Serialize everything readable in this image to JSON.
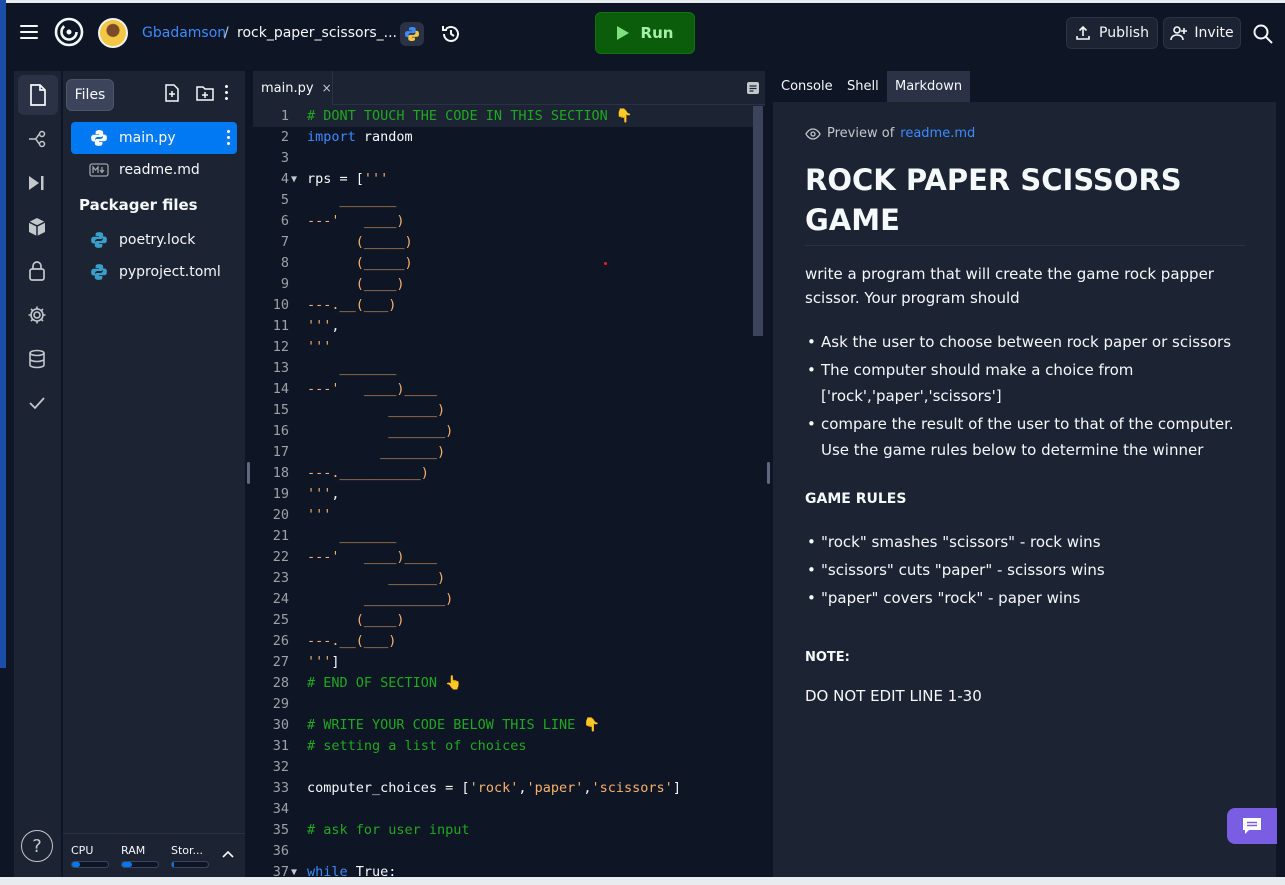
{
  "header": {
    "owner": "Gbadamson",
    "separator": "/",
    "repl_name": "rock_paper_scissors_...",
    "run_label": "Run",
    "publish_label": "Publish",
    "invite_label": "Invite"
  },
  "files_panel": {
    "tab_label": "Files",
    "files": [
      {
        "name": "main.py",
        "icon": "python-icon"
      },
      {
        "name": "readme.md",
        "icon": "markdown-icon"
      }
    ],
    "packager_title": "Packager files",
    "packager_files": [
      {
        "name": "poetry.lock",
        "icon": "python-icon"
      },
      {
        "name": "pyproject.toml",
        "icon": "python-icon"
      }
    ],
    "resources": [
      {
        "label": "CPU",
        "fill": 0.22
      },
      {
        "label": "RAM",
        "fill": 0.28
      },
      {
        "label": "Stor...",
        "fill": 0.05
      }
    ]
  },
  "editor": {
    "tab_label": "main.py",
    "tab_close": "×",
    "lines": [
      {
        "n": "1",
        "fold": "",
        "parts": [
          {
            "c": "c-cmt",
            "t": "# DONT TOUCH THE CODE IN THIS SECTION 👇"
          }
        ]
      },
      {
        "n": "2",
        "fold": "",
        "parts": [
          {
            "c": "c-kw",
            "t": "import"
          },
          {
            "c": "c-ident",
            "t": " random"
          }
        ]
      },
      {
        "n": "3",
        "fold": "",
        "parts": []
      },
      {
        "n": "4",
        "fold": "▼",
        "parts": [
          {
            "c": "c-ident",
            "t": "rps = ["
          },
          {
            "c": "c-str",
            "t": "'''"
          }
        ]
      },
      {
        "n": "5",
        "fold": "",
        "parts": [
          {
            "c": "c-str",
            "t": "    _______"
          }
        ]
      },
      {
        "n": "6",
        "fold": "",
        "parts": [
          {
            "c": "c-str",
            "t": "---'   ____)"
          }
        ]
      },
      {
        "n": "7",
        "fold": "",
        "parts": [
          {
            "c": "c-str",
            "t": "      (_____)"
          }
        ]
      },
      {
        "n": "8",
        "fold": "",
        "parts": [
          {
            "c": "c-str",
            "t": "      (_____)"
          }
        ]
      },
      {
        "n": "9",
        "fold": "",
        "parts": [
          {
            "c": "c-str",
            "t": "      (____)"
          }
        ]
      },
      {
        "n": "10",
        "fold": "",
        "parts": [
          {
            "c": "c-str",
            "t": "---.__(___)"
          }
        ]
      },
      {
        "n": "11",
        "fold": "",
        "parts": [
          {
            "c": "c-str",
            "t": "'''"
          },
          {
            "c": "c-ident",
            "t": ","
          }
        ]
      },
      {
        "n": "12",
        "fold": "",
        "parts": [
          {
            "c": "c-str",
            "t": "'''"
          }
        ]
      },
      {
        "n": "13",
        "fold": "",
        "parts": [
          {
            "c": "c-str",
            "t": "    _______"
          }
        ]
      },
      {
        "n": "14",
        "fold": "",
        "parts": [
          {
            "c": "c-str",
            "t": "---'   ____)____"
          }
        ]
      },
      {
        "n": "15",
        "fold": "",
        "parts": [
          {
            "c": "c-str",
            "t": "          ______)"
          }
        ]
      },
      {
        "n": "16",
        "fold": "",
        "parts": [
          {
            "c": "c-str",
            "t": "          _______)"
          }
        ]
      },
      {
        "n": "17",
        "fold": "",
        "parts": [
          {
            "c": "c-str",
            "t": "         _______)"
          }
        ]
      },
      {
        "n": "18",
        "fold": "",
        "parts": [
          {
            "c": "c-str",
            "t": "---.__________)"
          }
        ]
      },
      {
        "n": "19",
        "fold": "",
        "parts": [
          {
            "c": "c-str",
            "t": "'''"
          },
          {
            "c": "c-ident",
            "t": ","
          }
        ]
      },
      {
        "n": "20",
        "fold": "",
        "parts": [
          {
            "c": "c-str",
            "t": "'''"
          }
        ]
      },
      {
        "n": "21",
        "fold": "",
        "parts": [
          {
            "c": "c-str",
            "t": "    _______"
          }
        ]
      },
      {
        "n": "22",
        "fold": "",
        "parts": [
          {
            "c": "c-str",
            "t": "---'   ____)____"
          }
        ]
      },
      {
        "n": "23",
        "fold": "",
        "parts": [
          {
            "c": "c-str",
            "t": "          ______)"
          }
        ]
      },
      {
        "n": "24",
        "fold": "",
        "parts": [
          {
            "c": "c-str",
            "t": "       __________)"
          }
        ]
      },
      {
        "n": "25",
        "fold": "",
        "parts": [
          {
            "c": "c-str",
            "t": "      (____)"
          }
        ]
      },
      {
        "n": "26",
        "fold": "",
        "parts": [
          {
            "c": "c-str",
            "t": "---.__(___)"
          }
        ]
      },
      {
        "n": "27",
        "fold": "",
        "parts": [
          {
            "c": "c-str",
            "t": "'''"
          },
          {
            "c": "c-ident",
            "t": "]"
          }
        ]
      },
      {
        "n": "28",
        "fold": "",
        "parts": [
          {
            "c": "c-cmt",
            "t": "# END OF SECTION 👆"
          }
        ]
      },
      {
        "n": "29",
        "fold": "",
        "parts": []
      },
      {
        "n": "30",
        "fold": "",
        "parts": [
          {
            "c": "c-cmt",
            "t": "# WRITE YOUR CODE BELOW THIS LINE 👇"
          }
        ]
      },
      {
        "n": "31",
        "fold": "",
        "parts": [
          {
            "c": "c-cmt",
            "t": "# setting a list of choices"
          }
        ]
      },
      {
        "n": "32",
        "fold": "",
        "parts": []
      },
      {
        "n": "33",
        "fold": "",
        "parts": [
          {
            "c": "c-ident",
            "t": "computer_choices = ["
          },
          {
            "c": "c-str",
            "t": "'rock'"
          },
          {
            "c": "c-ident",
            "t": ","
          },
          {
            "c": "c-str",
            "t": "'paper'"
          },
          {
            "c": "c-ident",
            "t": ","
          },
          {
            "c": "c-str",
            "t": "'scissors'"
          },
          {
            "c": "c-ident",
            "t": "]"
          }
        ]
      },
      {
        "n": "34",
        "fold": "",
        "parts": []
      },
      {
        "n": "35",
        "fold": "",
        "parts": [
          {
            "c": "c-cmt",
            "t": "# ask for user input"
          }
        ]
      },
      {
        "n": "36",
        "fold": "",
        "parts": []
      },
      {
        "n": "37",
        "fold": "▼",
        "parts": [
          {
            "c": "c-kw",
            "t": "while"
          },
          {
            "c": "c-ident",
            "t": " True:"
          }
        ]
      }
    ]
  },
  "right_pane": {
    "tabs": [
      "Console",
      "Shell",
      "Markdown"
    ],
    "active_tab": "Markdown",
    "preview_prefix": "Preview of",
    "preview_file": "readme.md",
    "title": "ROCK PAPER SCISSORS GAME",
    "intro": "write a program that will create the game rock papper scissor. Your program should",
    "bullets": [
      "Ask the user to choose between rock paper or scissors",
      "The computer should make a choice from ['rock','paper','scissors']",
      "compare the result of the user to that of the computer. Use the game rules below to determine the winner"
    ],
    "rules_title": "GAME RULES",
    "rules": [
      "\"rock\" smashes \"scissors\" - rock wins",
      "\"scissors\" cuts \"paper\" - scissors wins",
      "\"paper\" covers \"rock\" - paper wins"
    ],
    "note_title": "NOTE:",
    "note_text": "DO NOT EDIT LINE 1-30"
  },
  "colors": {
    "run_green": "#0b5c0b",
    "accent_blue": "#0079f2",
    "chat_purple": "#795ee3"
  }
}
